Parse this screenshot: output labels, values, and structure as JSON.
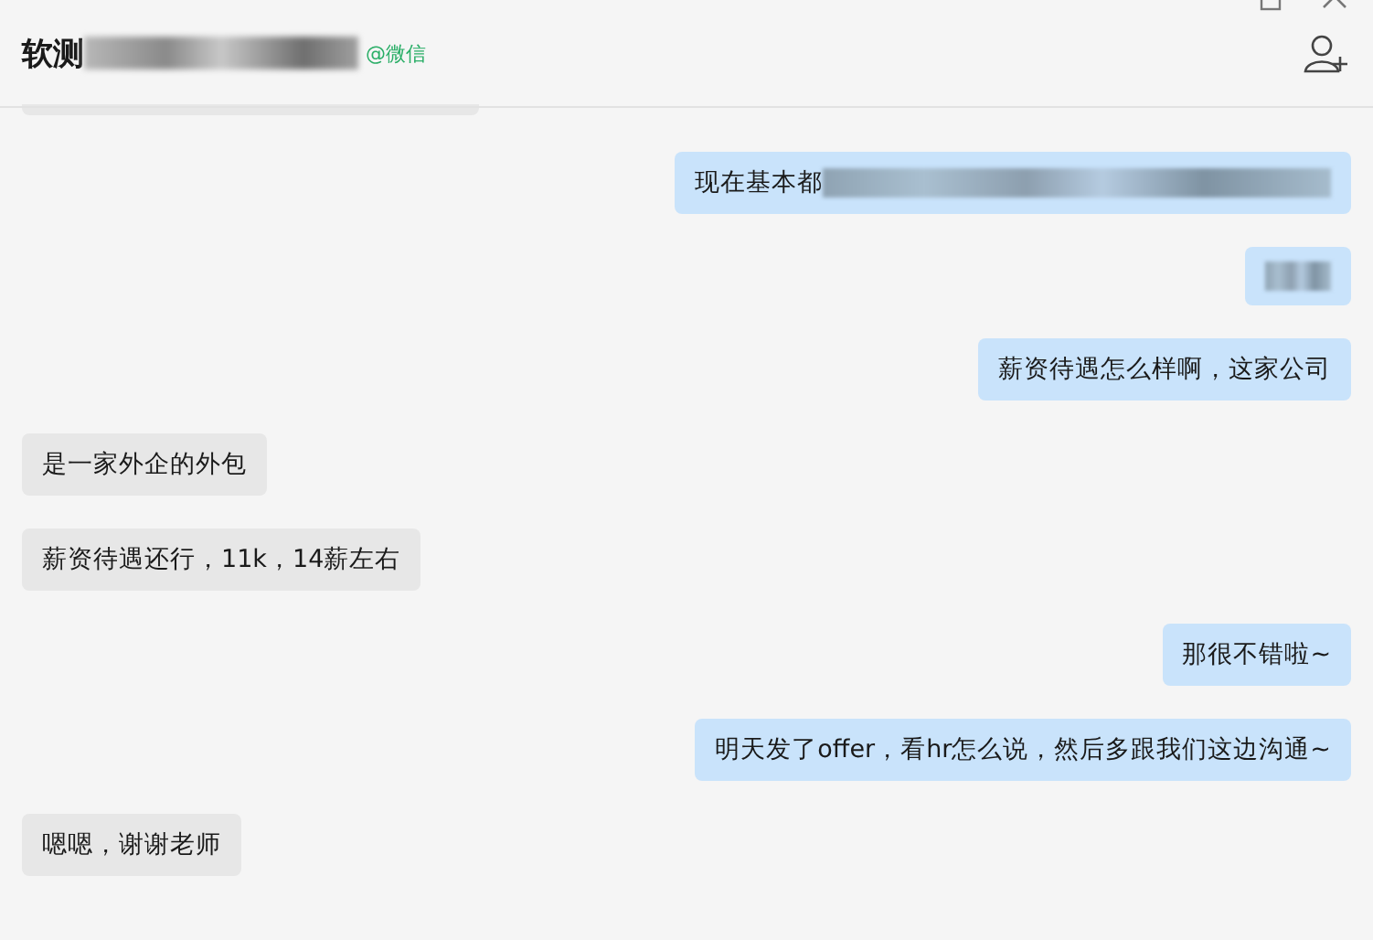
{
  "header": {
    "title": "软测",
    "title_redacted": true,
    "source_tag": "@微信"
  },
  "messages": [
    {
      "kind": "received",
      "cut_off": true
    },
    {
      "kind": "sent",
      "text": "现在基本都",
      "redacted": true
    },
    {
      "kind": "sent",
      "redacted": true
    },
    {
      "kind": "sent",
      "text": "薪资待遇怎么样啊，这家公司"
    },
    {
      "kind": "received",
      "text": "是一家外企的外包"
    },
    {
      "kind": "received",
      "text": "薪资待遇还行，11k，14薪左右"
    },
    {
      "kind": "sent",
      "text": "那很不错啦~"
    },
    {
      "kind": "sent",
      "text": "明天发了offer，看hr怎么说，然后多跟我们这边沟通~"
    },
    {
      "kind": "received",
      "text": "嗯嗯，谢谢老师"
    }
  ]
}
